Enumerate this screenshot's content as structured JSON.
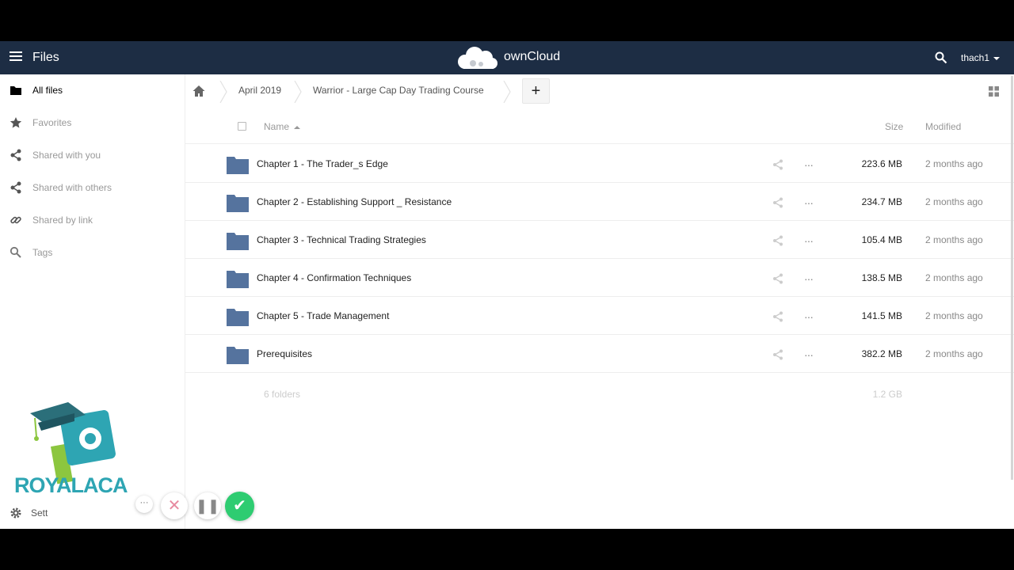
{
  "header": {
    "app_name": "Files",
    "brand": "ownCloud",
    "user": "thach1"
  },
  "sidebar": {
    "items": [
      {
        "label": "All files",
        "icon": "folder-icon",
        "active": true
      },
      {
        "label": "Favorites",
        "icon": "star-icon"
      },
      {
        "label": "Shared with you",
        "icon": "share-icon"
      },
      {
        "label": "Shared with others",
        "icon": "share-icon"
      },
      {
        "label": "Shared by link",
        "icon": "link-icon"
      },
      {
        "label": "Tags",
        "icon": "search-icon"
      }
    ],
    "promo_text": "ROYALACA",
    "settings_label": "Sett"
  },
  "controls": {
    "breadcrumbs": [
      "April 2019",
      "Warrior - Large Cap Day Trading Course"
    ],
    "new_label": "+"
  },
  "table": {
    "headers": {
      "name": "Name",
      "size": "Size",
      "modified": "Modified"
    },
    "rows": [
      {
        "name": "Chapter 1 - The Trader_s Edge",
        "size": "223.6 MB",
        "modified": "2 months ago"
      },
      {
        "name": "Chapter 2 - Establishing Support _ Resistance",
        "size": "234.7 MB",
        "modified": "2 months ago"
      },
      {
        "name": "Chapter 3 - Technical Trading Strategies",
        "size": "105.4 MB",
        "modified": "2 months ago"
      },
      {
        "name": "Chapter 4 - Confirmation Techniques",
        "size": "138.5 MB",
        "modified": "2 months ago"
      },
      {
        "name": "Chapter 5 - Trade Management",
        "size": "141.5 MB",
        "modified": "2 months ago"
      },
      {
        "name": "Prerequisites",
        "size": "382.2 MB",
        "modified": "2 months ago"
      }
    ],
    "summary": {
      "count": "6 folders",
      "total": "1.2 GB"
    }
  },
  "overlay": {
    "more_symbol": "···",
    "cancel_symbol": "✕",
    "pause_symbol": "❚❚",
    "confirm_symbol": "✔"
  },
  "colors": {
    "header_bg": "#1d2d44",
    "folder": "#55739e",
    "promo": "#2ea5b3",
    "confirm": "#2ecc71"
  }
}
